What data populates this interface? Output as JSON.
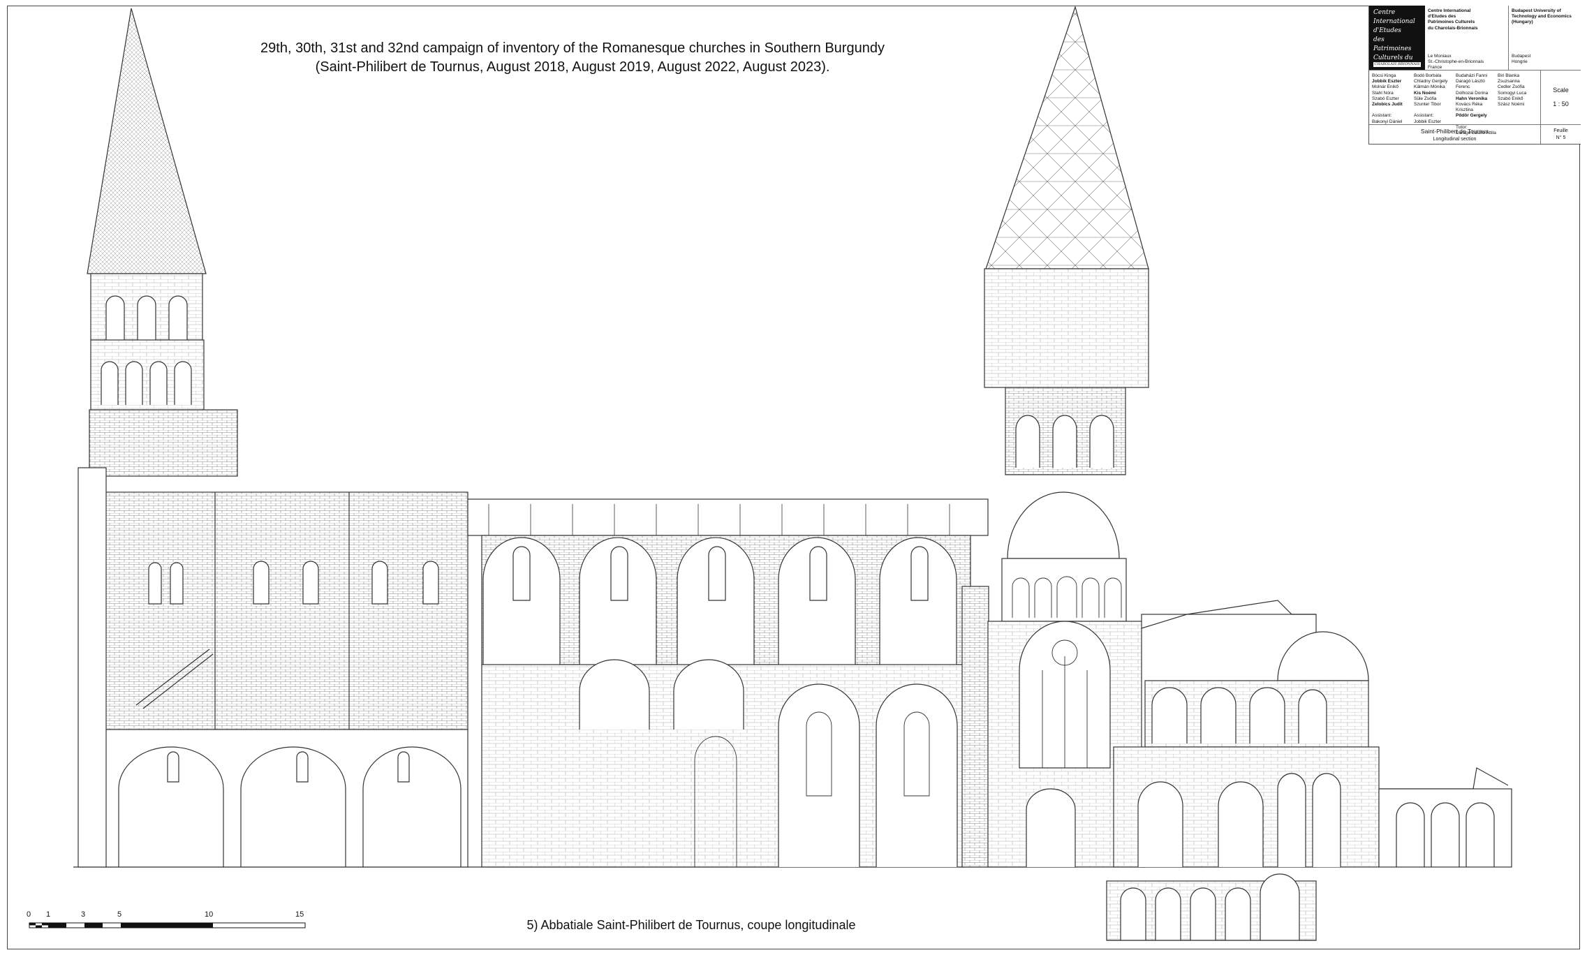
{
  "heading": {
    "line1": "29th, 30th, 31st and 32nd campaign of inventory of the Romanesque churches in Southern Burgundy",
    "line2": "(Saint-Philibert de Tournus, August 2018, August 2019, August 2022, August 2023)."
  },
  "caption": "5) Abbatiale Saint-Philibert de Tournus, coupe longitudinale",
  "scale_bar": {
    "ticks": [
      "0",
      "1",
      "3",
      "5",
      "10",
      "15"
    ]
  },
  "title_block": {
    "logo_lines": [
      "Centre",
      "International",
      "d'Etudes",
      "des Patrimoines",
      "Culturels du"
    ],
    "logo_band": "CHAROLAIS-BRIONNAIS",
    "org1": {
      "name_lines": [
        "Centre International",
        "d'Etudes des",
        "Patrimoines Culturels",
        "du Charolais-Brionnais"
      ],
      "address_lines": [
        "Le Moniaux",
        "St.-Christophe-en-Brionnais",
        "France"
      ]
    },
    "org2": {
      "name_lines": [
        "Budapest University of",
        "Technology and Economics",
        "(Hungary)"
      ],
      "address_lines": [
        "Budapest",
        "Hongrie"
      ]
    },
    "team": {
      "col1": [
        "Bócsi Kinga",
        "Jobbik Eszter",
        "Molnár Enikő",
        "Stahl Nóra",
        "Szabó Eszter",
        "Zelobics Judit",
        "",
        "Assistant:",
        "Bakonyi Dániel"
      ],
      "col2": [
        "Bodó Borbála",
        "Chladny Gergely",
        "Kálmán Mónika",
        "Kis Noémi",
        "Süle Zsófia",
        "Szunter Tibor",
        "",
        "Assistant:",
        "Jobbik Eszter"
      ],
      "col3": [
        "Budaházi Fanni",
        "Daragó László Ferenc",
        "Dolhozai Dorina",
        "Hahn Veronika",
        "Kovács Réka Krisztina",
        "Pődör Gergely",
        "",
        "Tutor:",
        "Daragó László Attila"
      ],
      "col4": [
        "Biri Blanka Zsuzsanna",
        "Cedler Zsófia",
        "Somogyi Luca",
        "Szabó Enikő",
        "Szász Noémi"
      ]
    },
    "scale_label": "Scale",
    "scale_value": "1 : 50",
    "sheet_title": "Saint-Philibert de Tournus",
    "sheet_subtitle": "Longitudinal section",
    "feuille_label": "Feuille",
    "feuille_number": "N° 5"
  }
}
